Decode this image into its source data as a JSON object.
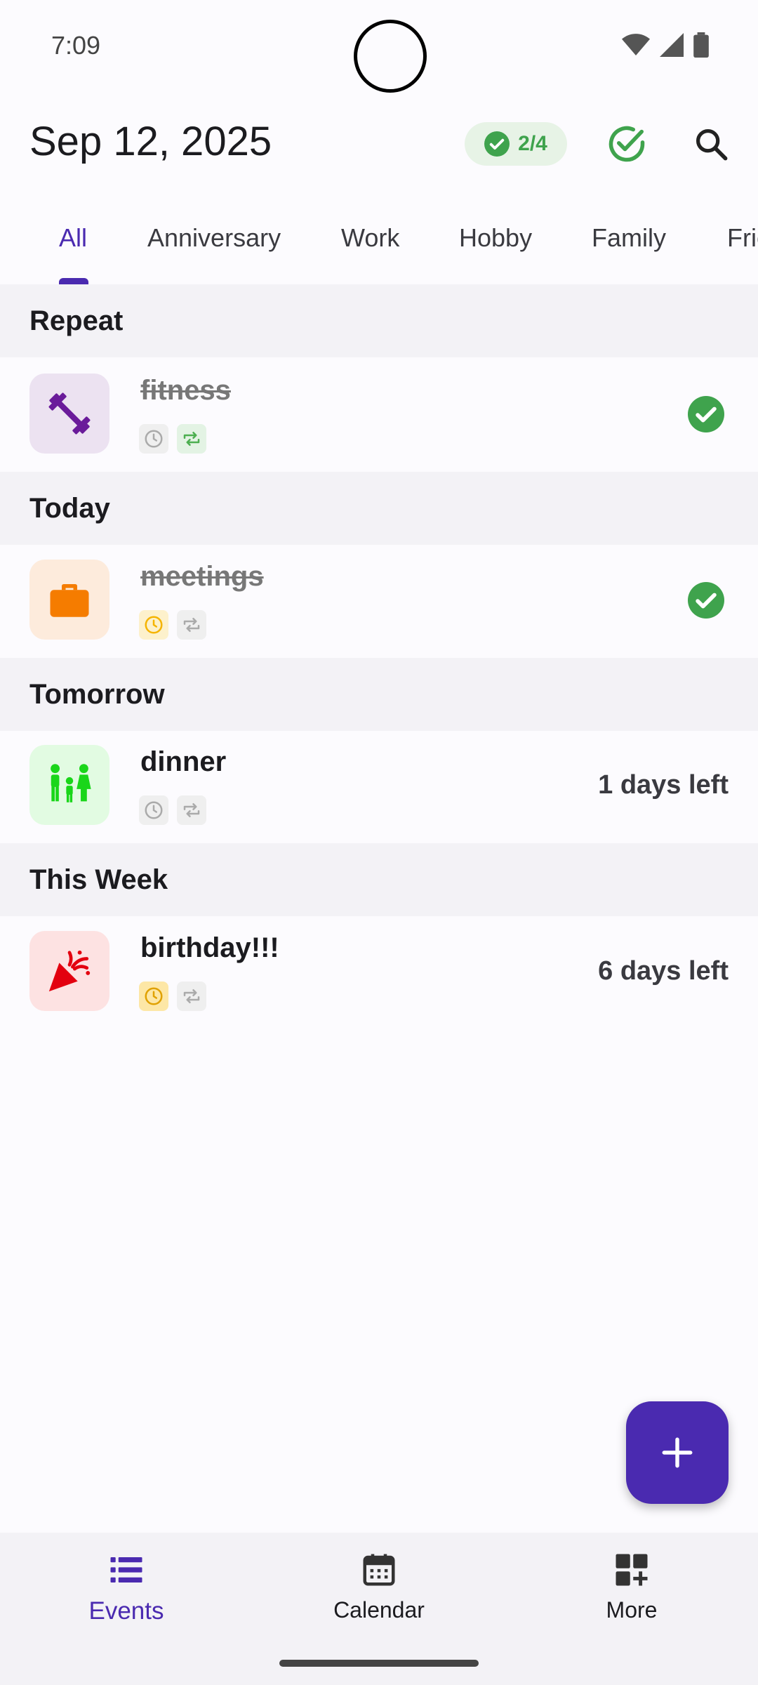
{
  "status_bar": {
    "time": "7:09",
    "icons": [
      "wifi-icon",
      "signal-icon",
      "battery-icon"
    ]
  },
  "header": {
    "date": "Sep 12, 2025",
    "progress": "2/4",
    "icons": {
      "progress": "check-circle-icon",
      "done_all": "check-circle-outline-icon",
      "search": "search-icon"
    }
  },
  "tabs": [
    {
      "label": "All",
      "active": true
    },
    {
      "label": "Anniversary",
      "active": false
    },
    {
      "label": "Work",
      "active": false
    },
    {
      "label": "Hobby",
      "active": false
    },
    {
      "label": "Family",
      "active": false
    },
    {
      "label": "Frie",
      "active": false
    }
  ],
  "sections": [
    {
      "title": "Repeat"
    },
    {
      "title": "Today"
    },
    {
      "title": "Tomorrow"
    },
    {
      "title": "This Week"
    }
  ],
  "events": [
    {
      "name": "fitness",
      "completed": true,
      "icon": "dumbbell-icon",
      "icon_color": "#6a1b9a",
      "icon_bg": "#ece2f1",
      "right_text": "",
      "time_highlight": false,
      "repeat_highlight": true
    },
    {
      "name": "meetings",
      "completed": true,
      "icon": "briefcase-icon",
      "icon_color": "#f57c00",
      "icon_bg": "#fdebdc",
      "right_text": "",
      "time_highlight": true,
      "repeat_highlight": false
    },
    {
      "name": "dinner",
      "completed": false,
      "icon": "family-icon",
      "icon_color": "#1ad61a",
      "icon_bg": "#e2fbe2",
      "right_text": "1 days left",
      "time_highlight": false,
      "repeat_highlight": false
    },
    {
      "name": "birthday!!!",
      "completed": false,
      "icon": "party-popper-icon",
      "icon_color": "#e3000f",
      "icon_bg": "#fde2e2",
      "right_text": "6 days left",
      "time_highlight": true,
      "repeat_highlight": false
    }
  ],
  "colors": {
    "accent": "#4a2ab0",
    "success": "#3fa34d",
    "time_highlight": "#f5b400",
    "repeat_highlight": "#4caf50"
  },
  "fab": {
    "icon": "plus-icon"
  },
  "bottom_nav": [
    {
      "label": "Events",
      "icon": "list-icon",
      "active": true
    },
    {
      "label": "Calendar",
      "icon": "calendar-icon",
      "active": false
    },
    {
      "label": "More",
      "icon": "widgets-add-icon",
      "active": false
    }
  ]
}
